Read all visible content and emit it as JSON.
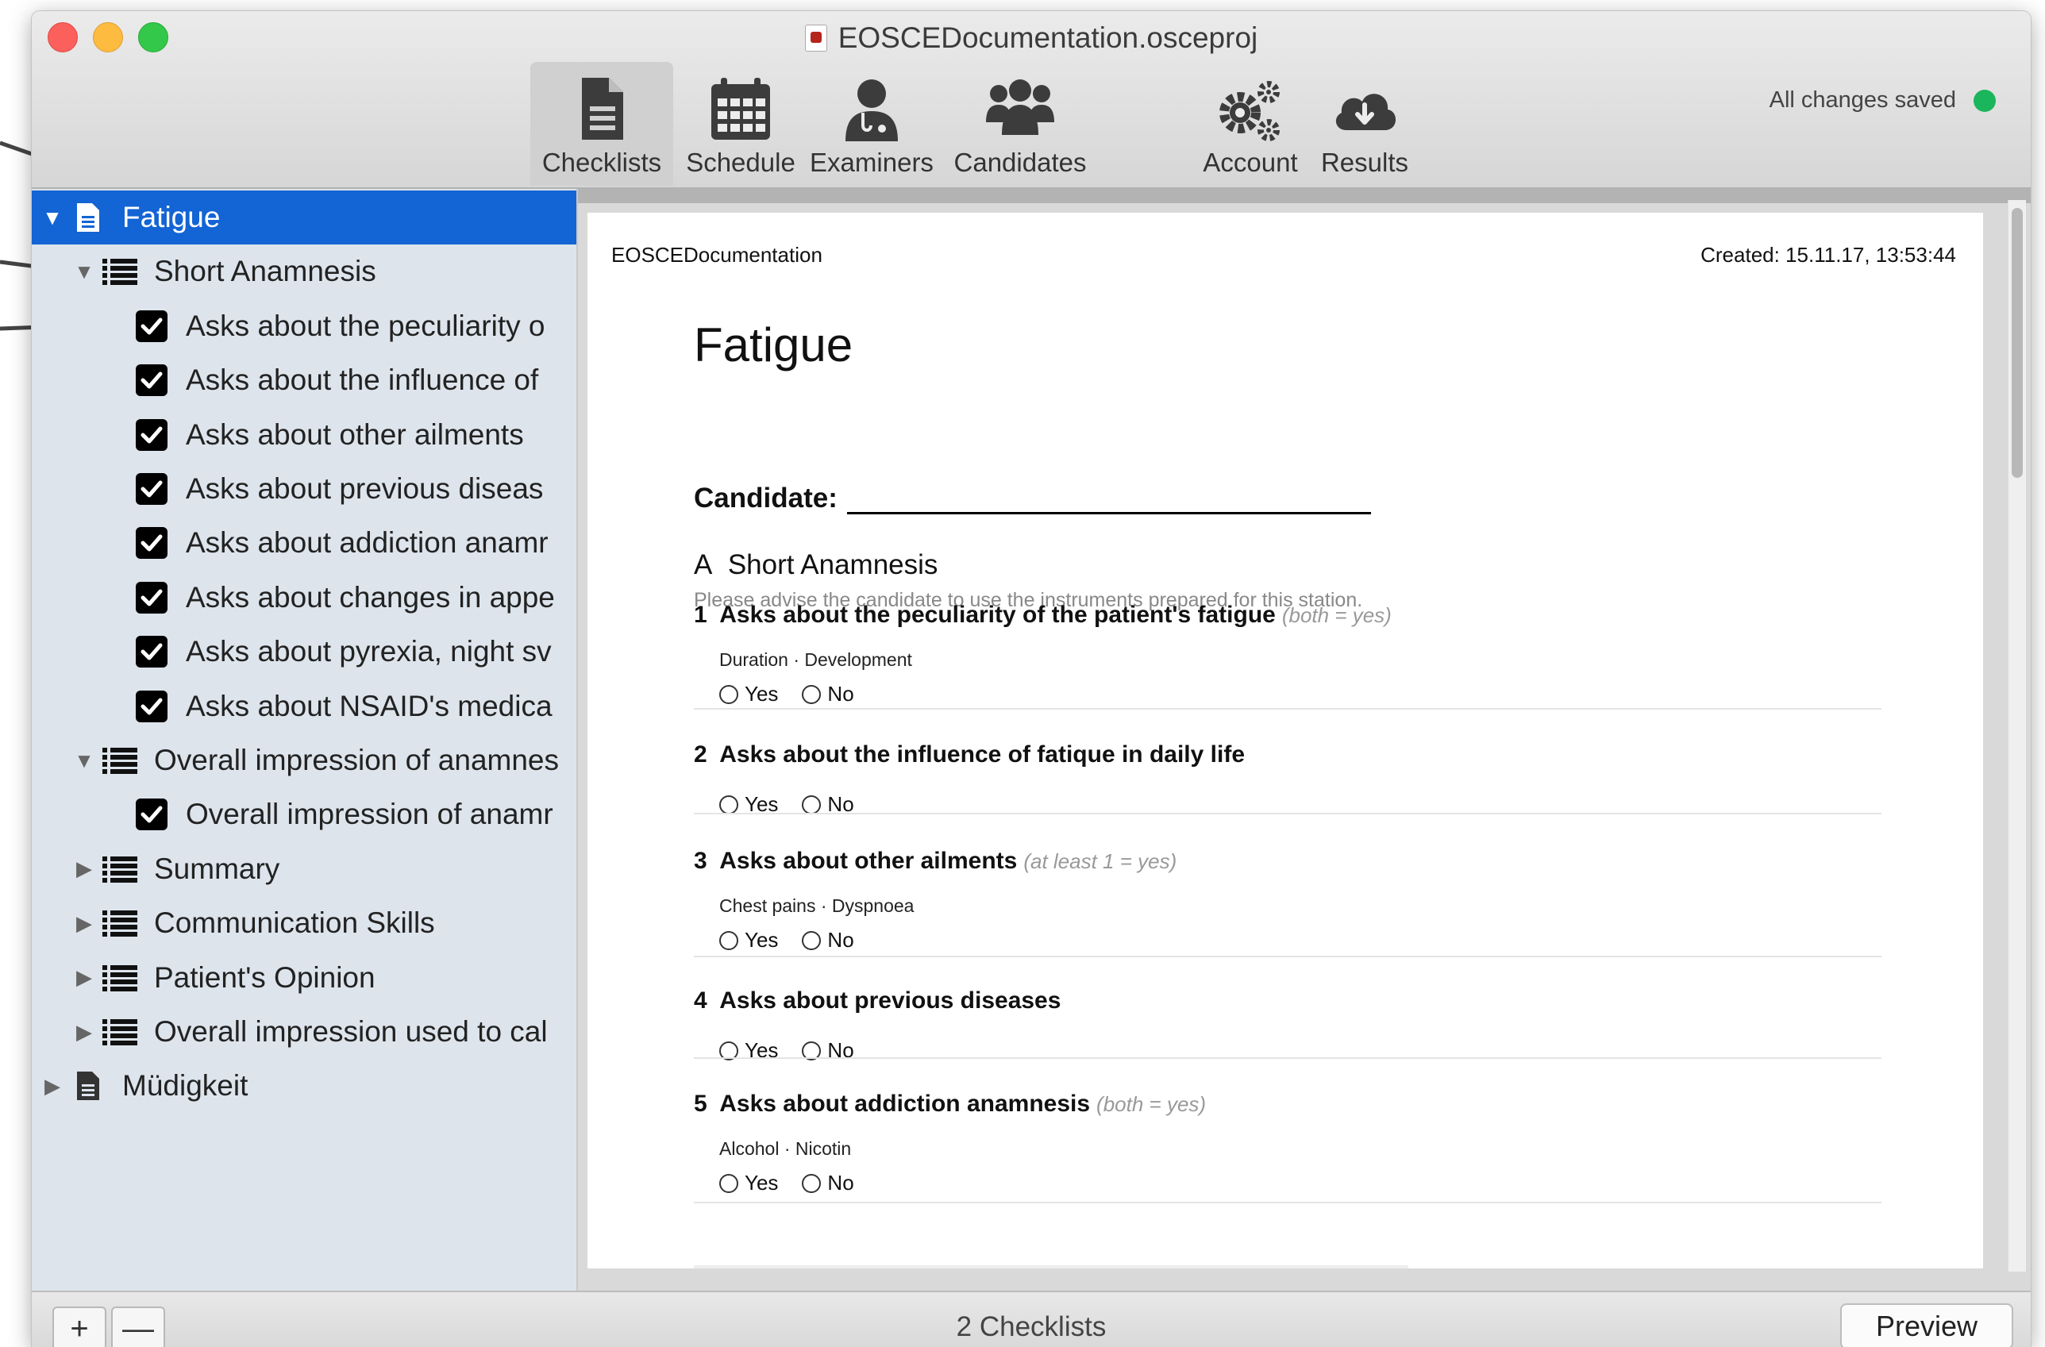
{
  "window": {
    "title": "EOSCEDocumentation.osceproj"
  },
  "toolbar": {
    "items": [
      {
        "label": "Checklists",
        "icon": "checklist-doc-icon",
        "active": true
      },
      {
        "label": "Schedule",
        "icon": "calendar-icon"
      },
      {
        "label": "Examiners",
        "icon": "doctor-icon"
      },
      {
        "label": "Candidates",
        "icon": "people-group-icon"
      },
      {
        "label": "Account",
        "icon": "gears-icon"
      },
      {
        "label": "Results",
        "icon": "cloud-download-icon"
      }
    ],
    "status": "All changes saved",
    "status_color": "#1bb55c"
  },
  "sidebar": {
    "selected_color": "#1364d4",
    "rows": [
      {
        "label": "Fatigue"
      },
      {
        "label": "Short Anamnesis"
      },
      {
        "label": "Asks about the peculiarity o"
      },
      {
        "label": "Asks about the influence of"
      },
      {
        "label": "Asks about other ailments"
      },
      {
        "label": "Asks about previous diseas"
      },
      {
        "label": "Asks about addiction anamr"
      },
      {
        "label": "Asks about changes in appe"
      },
      {
        "label": "Asks about pyrexia, night sv"
      },
      {
        "label": "Asks about NSAID's medica"
      },
      {
        "label": "Overall impression of anamnes"
      },
      {
        "label": "Overall impression of anamr"
      },
      {
        "label": "Summary"
      },
      {
        "label": "Communication Skills"
      },
      {
        "label": "Patient's Opinion"
      },
      {
        "label": "Overall impression used to cal"
      },
      {
        "label": "Müdigkeit"
      }
    ]
  },
  "preview": {
    "header_left": "EOSCEDocumentation",
    "header_right": "Created: 15.11.17, 13:53:44",
    "title": "Fatigue",
    "candidate_label": "Candidate:",
    "section": {
      "letter": "A",
      "title": "Short Anamnesis",
      "note": "Please advise the candidate to use the instruments prepared for this station."
    },
    "yes_label": "Yes",
    "no_label": "No",
    "questions": [
      {
        "num": "1",
        "text": "Asks about the peculiarity of the patient's fatigue",
        "hint": "(both = yes)",
        "sub": "Duration  ·  Development"
      },
      {
        "num": "2",
        "text": "Asks about the influence of fatique in daily life",
        "hint": "",
        "sub": ""
      },
      {
        "num": "3",
        "text": "Asks about other ailments",
        "hint": "(at least 1 = yes)",
        "sub": "Chest pains  ·  Dyspnoea"
      },
      {
        "num": "4",
        "text": "Asks about previous diseases",
        "hint": "",
        "sub": ""
      },
      {
        "num": "5",
        "text": "Asks about addiction anamnesis",
        "hint": "(both = yes)",
        "sub": "Alcohol  ·  Nicotin"
      }
    ]
  },
  "bottom": {
    "add_label": "+",
    "remove_label": "—",
    "count": "2 Checklists",
    "preview_button": "Preview"
  }
}
